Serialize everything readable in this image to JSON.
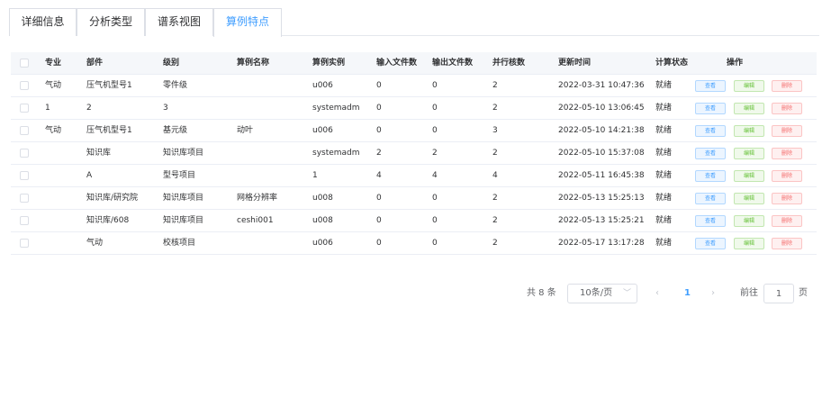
{
  "tabs": [
    {
      "label": "详细信息",
      "active": false
    },
    {
      "label": "分析类型",
      "active": false
    },
    {
      "label": "谱系视图",
      "active": false
    },
    {
      "label": "算例特点",
      "active": true
    }
  ],
  "table": {
    "columns": [
      "专业",
      "部件",
      "级别",
      "算例名称",
      "算例实例",
      "输入文件数",
      "输出文件数",
      "并行核数",
      "更新时间",
      "计算状态",
      "操作"
    ],
    "actions": {
      "view": "查看",
      "edit": "编辑",
      "delete": "删除"
    },
    "rows": [
      [
        "气动",
        "压气机型号1",
        "零件级",
        "",
        "u006",
        "0",
        "0",
        "2",
        "2022-03-31 10:47:36",
        "就绪"
      ],
      [
        "1",
        "2",
        "3",
        "",
        "systemadm",
        "0",
        "0",
        "2",
        "2022-05-10 13:06:45",
        "就绪"
      ],
      [
        "气动",
        "压气机型号1",
        "基元级",
        "动叶",
        "u006",
        "0",
        "0",
        "3",
        "2022-05-10 14:21:38",
        "就绪"
      ],
      [
        "",
        "知识库",
        "知识库项目",
        "",
        "systemadm",
        "2",
        "2",
        "2",
        "2022-05-10 15:37:08",
        "就绪"
      ],
      [
        "",
        "A",
        "型号项目",
        "",
        "1",
        "4",
        "4",
        "4",
        "2022-05-11 16:45:38",
        "就绪"
      ],
      [
        "",
        "知识库/研究院",
        "知识库项目",
        "网格分辨率",
        "u008",
        "0",
        "0",
        "2",
        "2022-05-13 15:25:13",
        "就绪"
      ],
      [
        "",
        "知识库/608",
        "知识库项目",
        "ceshi001",
        "u008",
        "0",
        "0",
        "2",
        "2022-05-13 15:25:21",
        "就绪"
      ],
      [
        "",
        "气动",
        "校核项目",
        "",
        "u006",
        "0",
        "0",
        "2",
        "2022-05-17 13:17:28",
        "就绪"
      ]
    ]
  },
  "pagination": {
    "total": "共 8 条",
    "page_size": "10条/页",
    "prev": "‹",
    "current_page": "1",
    "next": "›",
    "goto_label": "前往",
    "goto_value": "1",
    "goto_unit": "页"
  }
}
